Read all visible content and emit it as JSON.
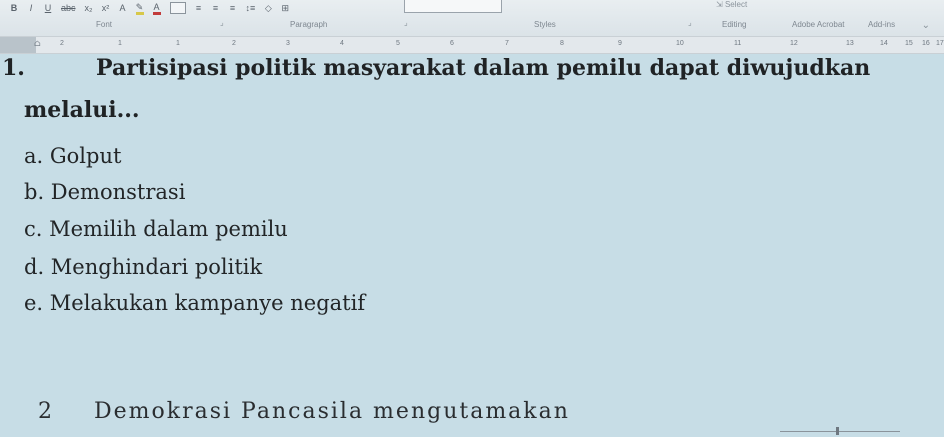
{
  "ribbon": {
    "format_buttons": [
      "B",
      "I",
      "U",
      "abc",
      "x₂",
      "x²",
      "A"
    ],
    "group_labels": {
      "font": "Font",
      "paragraph": "Paragraph",
      "styles": "Styles",
      "editing": "Editing",
      "adobe": "Adobe Acrobat",
      "addins": "Add-ins"
    },
    "select_label": "Select"
  },
  "ruler": {
    "ticks": [
      "2",
      "1",
      "1",
      "2",
      "3",
      "4",
      "5",
      "6",
      "7",
      "8",
      "9",
      "10",
      "11",
      "12",
      "13",
      "14",
      "15",
      "16",
      "17"
    ]
  },
  "question": {
    "number": "1.",
    "text_line1": "Partisipasi politik masyarakat dalam pemilu dapat diwujudkan",
    "text_line2": "melalui...",
    "options": [
      "a. Golput",
      "b. Demonstrasi",
      "c. Memilih dalam pemilu",
      "d. Menghindari politik",
      "e. Melakukan kampanye negatif"
    ]
  },
  "next_question": {
    "number": "2",
    "text": "Demokrasi Pancasila mengutamakan"
  }
}
